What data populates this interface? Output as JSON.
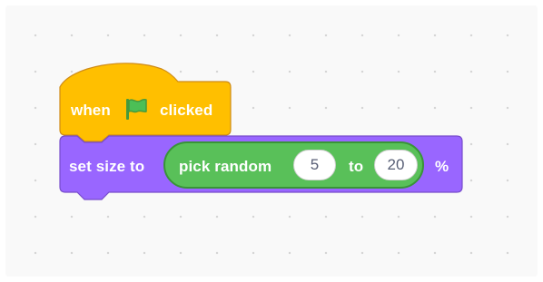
{
  "hat_block": {
    "when_label": "when",
    "flag_icon": "green-flag-icon",
    "clicked_label": "clicked",
    "color": "#ffbf00",
    "border_color": "#cf8b17"
  },
  "set_size_block": {
    "label": "set size to",
    "percent_label": "%",
    "color": "#9966ff",
    "border_color": "#774dcb"
  },
  "pick_random_block": {
    "label": "pick random",
    "from_value": "5",
    "to_label": "to",
    "to_value": "20",
    "color": "#59c059",
    "border_color": "#389438"
  }
}
